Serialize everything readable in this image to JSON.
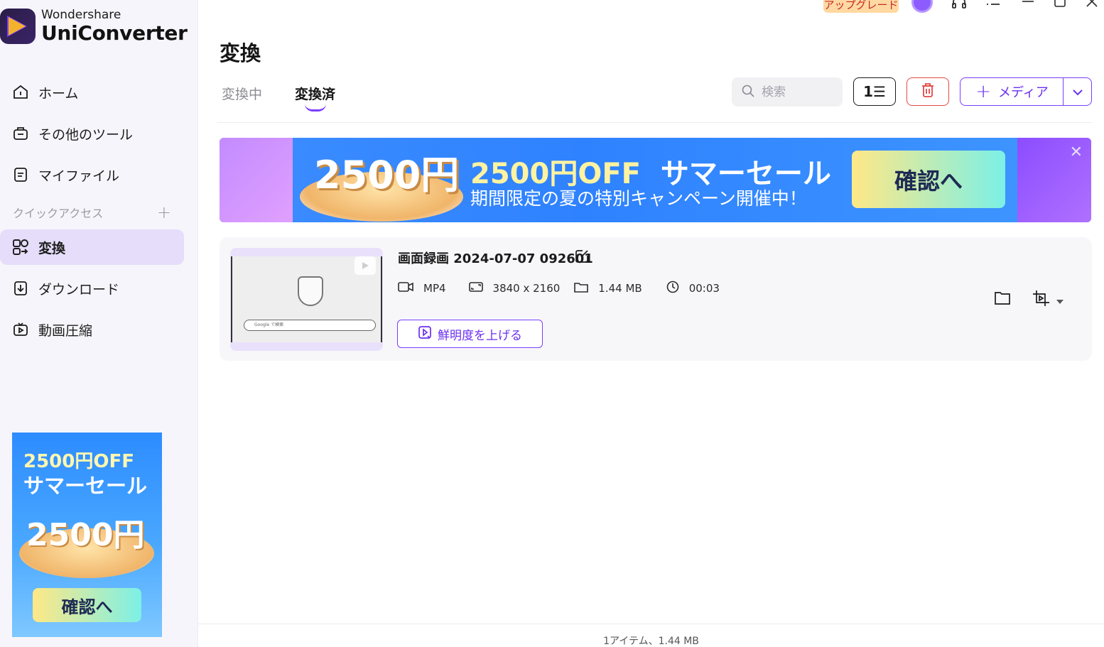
{
  "app": {
    "brand": "Wondershare",
    "product": "UniConverter"
  },
  "titlebar": {
    "upgrade_label": "アップグレード",
    "icons": [
      "avatar-icon",
      "headset-icon",
      "menu-icon",
      "minimize-icon",
      "maximize-icon",
      "close-icon"
    ]
  },
  "sidebar": {
    "items": [
      {
        "label": "ホーム",
        "icon": "home-icon"
      },
      {
        "label": "その他のツール",
        "icon": "toolbox-icon"
      },
      {
        "label": "マイファイル",
        "icon": "file-icon"
      }
    ],
    "quick_access_label": "クイックアクセス",
    "quick_access_add": "+",
    "quick_items": [
      {
        "label": "変換",
        "icon": "convert-icon",
        "active": true
      },
      {
        "label": "ダウンロード",
        "icon": "download-icon"
      },
      {
        "label": "動画圧縮",
        "icon": "compress-icon"
      }
    ],
    "ad": {
      "line1": "2500円OFF",
      "line2": "サマーセール",
      "big": "2500円",
      "cta": "確認へ"
    }
  },
  "main": {
    "title": "変換",
    "tabs": [
      {
        "label": "変換中",
        "active": false
      },
      {
        "label": "変換済",
        "active": true
      }
    ],
    "search_placeholder": "検索",
    "list_button_label": "1☰",
    "add_media_label": "メディア"
  },
  "banner": {
    "big": "2500円",
    "headline_off": "2500円OFF",
    "headline_rest": "サマーセール",
    "subline": "期間限定の夏の特別キャンペーン開催中！",
    "cta": "確認へ"
  },
  "file": {
    "name": "画面録画 2024-07-07 092601",
    "format": "MP4",
    "resolution": "3840 x 2160",
    "size": "1.44 MB",
    "duration": "00:03",
    "enhance_label": "鮮明度を上げる",
    "thumb_search_text": "Google で検索"
  },
  "footer": {
    "summary": "1アイテム、1.44 MB"
  },
  "colors": {
    "accent": "#7b3dff",
    "sidebar_bg": "#f6f5fb",
    "active_nav": "#e6ddfa",
    "delete": "#e24848"
  }
}
